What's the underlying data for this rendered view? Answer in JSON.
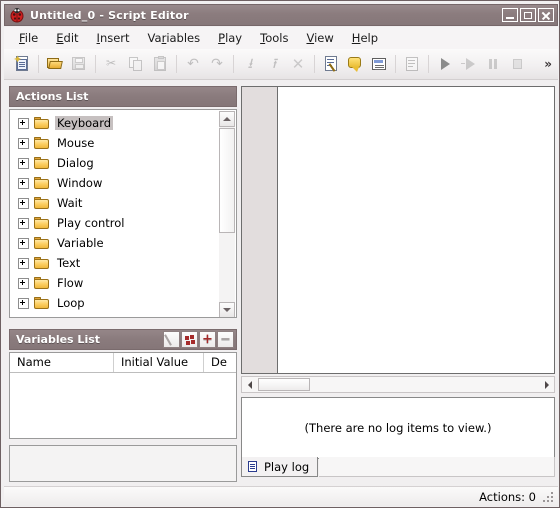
{
  "window": {
    "title": "Untitled_0 - Script Editor",
    "app_icon": "ladybug-icon",
    "controls": {
      "minimize": "Minimize",
      "maximize": "Maximize",
      "close": "Close"
    }
  },
  "menubar": {
    "items": [
      {
        "label": "File",
        "accel": "F"
      },
      {
        "label": "Edit",
        "accel": "E"
      },
      {
        "label": "Insert",
        "accel": "I"
      },
      {
        "label": "Variables",
        "accel": "V"
      },
      {
        "label": "Play",
        "accel": "P"
      },
      {
        "label": "Tools",
        "accel": "T"
      },
      {
        "label": "View",
        "accel": "V"
      },
      {
        "label": "Help",
        "accel": "H"
      }
    ]
  },
  "toolbar": {
    "overflow_label": "»",
    "buttons": [
      {
        "name": "new-script-button",
        "icon": "new-document-icon",
        "enabled": true
      },
      {
        "name": "open-button",
        "icon": "open-folder-icon",
        "enabled": true
      },
      {
        "name": "save-button",
        "icon": "save-disk-icon",
        "enabled": false
      },
      {
        "name": "cut-button",
        "icon": "scissors-icon",
        "enabled": false
      },
      {
        "name": "copy-button",
        "icon": "copy-icon",
        "enabled": false
      },
      {
        "name": "paste-button",
        "icon": "clipboard-paste-icon",
        "enabled": false
      },
      {
        "name": "undo-button",
        "icon": "undo-arrow-icon",
        "enabled": false
      },
      {
        "name": "redo-button",
        "icon": "redo-arrow-icon",
        "enabled": false
      },
      {
        "name": "move-down-button",
        "icon": "arrow-down-icon",
        "enabled": false
      },
      {
        "name": "move-up-button",
        "icon": "arrow-up-icon",
        "enabled": false
      },
      {
        "name": "delete-button",
        "icon": "x-delete-icon",
        "enabled": false
      },
      {
        "name": "edit-action-button",
        "icon": "edit-note-icon",
        "enabled": true
      },
      {
        "name": "comment-button",
        "icon": "speech-bubble-icon",
        "enabled": true
      },
      {
        "name": "properties-button",
        "icon": "list-window-icon",
        "enabled": true
      },
      {
        "name": "script-list-button",
        "icon": "script-list-icon",
        "enabled": false
      },
      {
        "name": "play-button",
        "icon": "play-triangle-icon",
        "enabled": true
      },
      {
        "name": "step-button",
        "icon": "step-play-icon",
        "enabled": false
      },
      {
        "name": "pause-button",
        "icon": "pause-icon",
        "enabled": false
      },
      {
        "name": "stop-button",
        "icon": "stop-square-icon",
        "enabled": false
      }
    ]
  },
  "actions_panel": {
    "title": "Actions List",
    "tree": [
      {
        "label": "Keyboard",
        "selected": true
      },
      {
        "label": "Mouse",
        "selected": false
      },
      {
        "label": "Dialog",
        "selected": false
      },
      {
        "label": "Window",
        "selected": false
      },
      {
        "label": "Wait",
        "selected": false
      },
      {
        "label": "Play control",
        "selected": false
      },
      {
        "label": "Variable",
        "selected": false
      },
      {
        "label": "Text",
        "selected": false
      },
      {
        "label": "Flow",
        "selected": false
      },
      {
        "label": "Loop",
        "selected": false
      }
    ]
  },
  "variables_panel": {
    "title": "Variables List",
    "buttons": [
      {
        "name": "edit-variable-button",
        "icon": "pencil-icon",
        "enabled": false
      },
      {
        "name": "duplicate-variable-button",
        "icon": "multi-add-icon",
        "enabled": true
      },
      {
        "name": "add-variable-button",
        "icon": "plus-icon",
        "enabled": true
      },
      {
        "name": "remove-variable-button",
        "icon": "minus-icon",
        "enabled": false
      }
    ],
    "columns": [
      "Name",
      "Initial Value",
      "De"
    ],
    "rows": []
  },
  "log_panel": {
    "empty_message": "(There are no log items to view.)",
    "tabs": [
      {
        "label": "Play log",
        "icon": "page-icon",
        "active": true
      }
    ]
  },
  "statusbar": {
    "actions_count": "Actions: 0"
  },
  "colors": {
    "titlebar": "#8a7b7d",
    "panel_header": "#8a7b7d",
    "accent_folder": "#f0bd46",
    "selection": "#c6c0c0",
    "window_bg": "#f1eff0"
  }
}
